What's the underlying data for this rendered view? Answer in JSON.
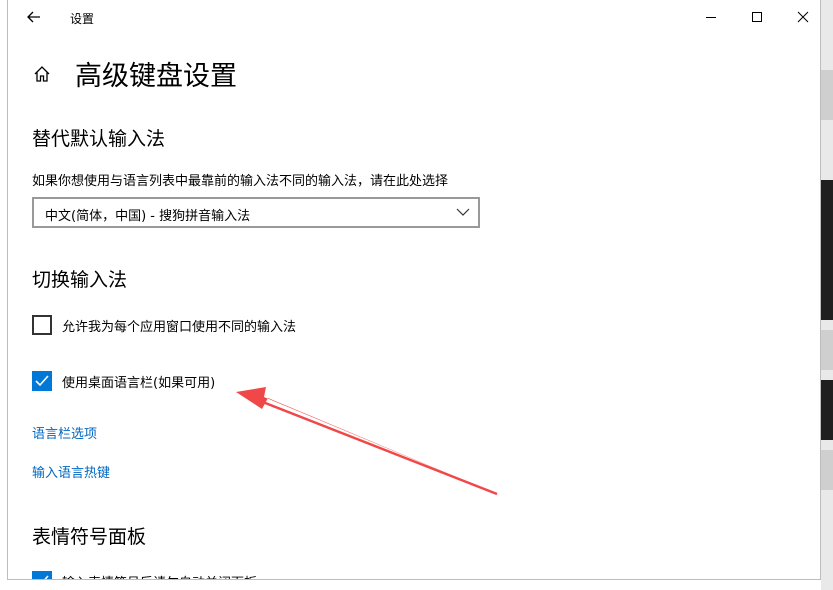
{
  "window": {
    "title": "设置"
  },
  "page": {
    "title": "高级键盘设置"
  },
  "override_input": {
    "heading": "替代默认输入法",
    "description": "如果你想使用与语言列表中最靠前的输入法不同的输入法，请在此处选择",
    "selected_option": "中文(简体，中国) - 搜狗拼音输入法"
  },
  "switch_input": {
    "heading": "切换输入法",
    "per_app_checkbox": {
      "label": "允许我为每个应用窗口使用不同的输入法",
      "checked": false
    },
    "language_bar_checkbox": {
      "label": "使用桌面语言栏(如果可用)",
      "checked": true
    },
    "language_bar_options_link": "语言栏选项",
    "input_hotkeys_link": "输入语言热键"
  },
  "emoji_panel": {
    "heading": "表情符号面板",
    "auto_close_checkbox": {
      "label": "输入表情符号后请勿自动关闭面板",
      "checked": true
    }
  },
  "colors": {
    "accent": "#0078d7",
    "link": "#0067c0",
    "annotation_arrow": "#f04848"
  },
  "icons": {
    "back": "back-arrow-icon",
    "minimize": "minimize-icon",
    "maximize": "maximize-icon",
    "close": "close-icon",
    "home": "home-icon",
    "dropdown": "chevron-down-icon",
    "check": "checkmark-icon"
  }
}
